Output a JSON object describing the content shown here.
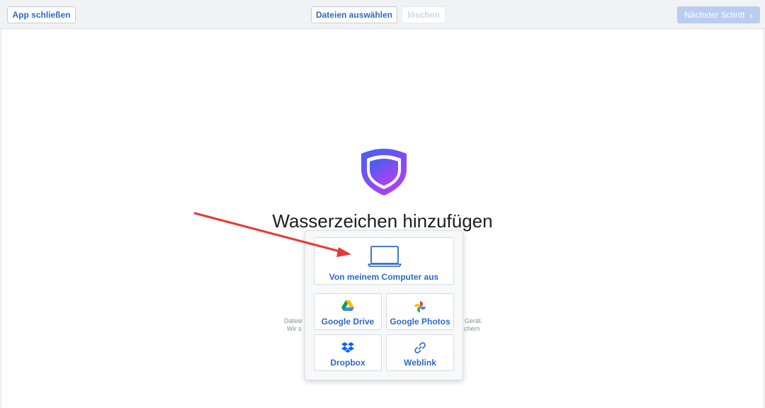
{
  "toolbar": {
    "close_label": "App schließen",
    "select_files_label": "Dateien auswählen",
    "delete_label": "löschen",
    "next_label": "Nächster Schritt"
  },
  "main": {
    "title": "Wasserzeichen hinzufügen",
    "hint_left_1": "Dateie",
    "hint_left_2": "Wir s",
    "hint_right_1": "Gerät.",
    "hint_right_2": "chern"
  },
  "sources": {
    "computer_label": "Von meinem Computer aus",
    "google_drive_label": "Google Drive",
    "google_photos_label": "Google Photos",
    "dropbox_label": "Dropbox",
    "weblink_label": "Weblink"
  },
  "colors": {
    "accent": "#2c69c9",
    "shield_start": "#3b63f5",
    "shield_end": "#b13ff0",
    "annotation_arrow": "#e53935"
  }
}
